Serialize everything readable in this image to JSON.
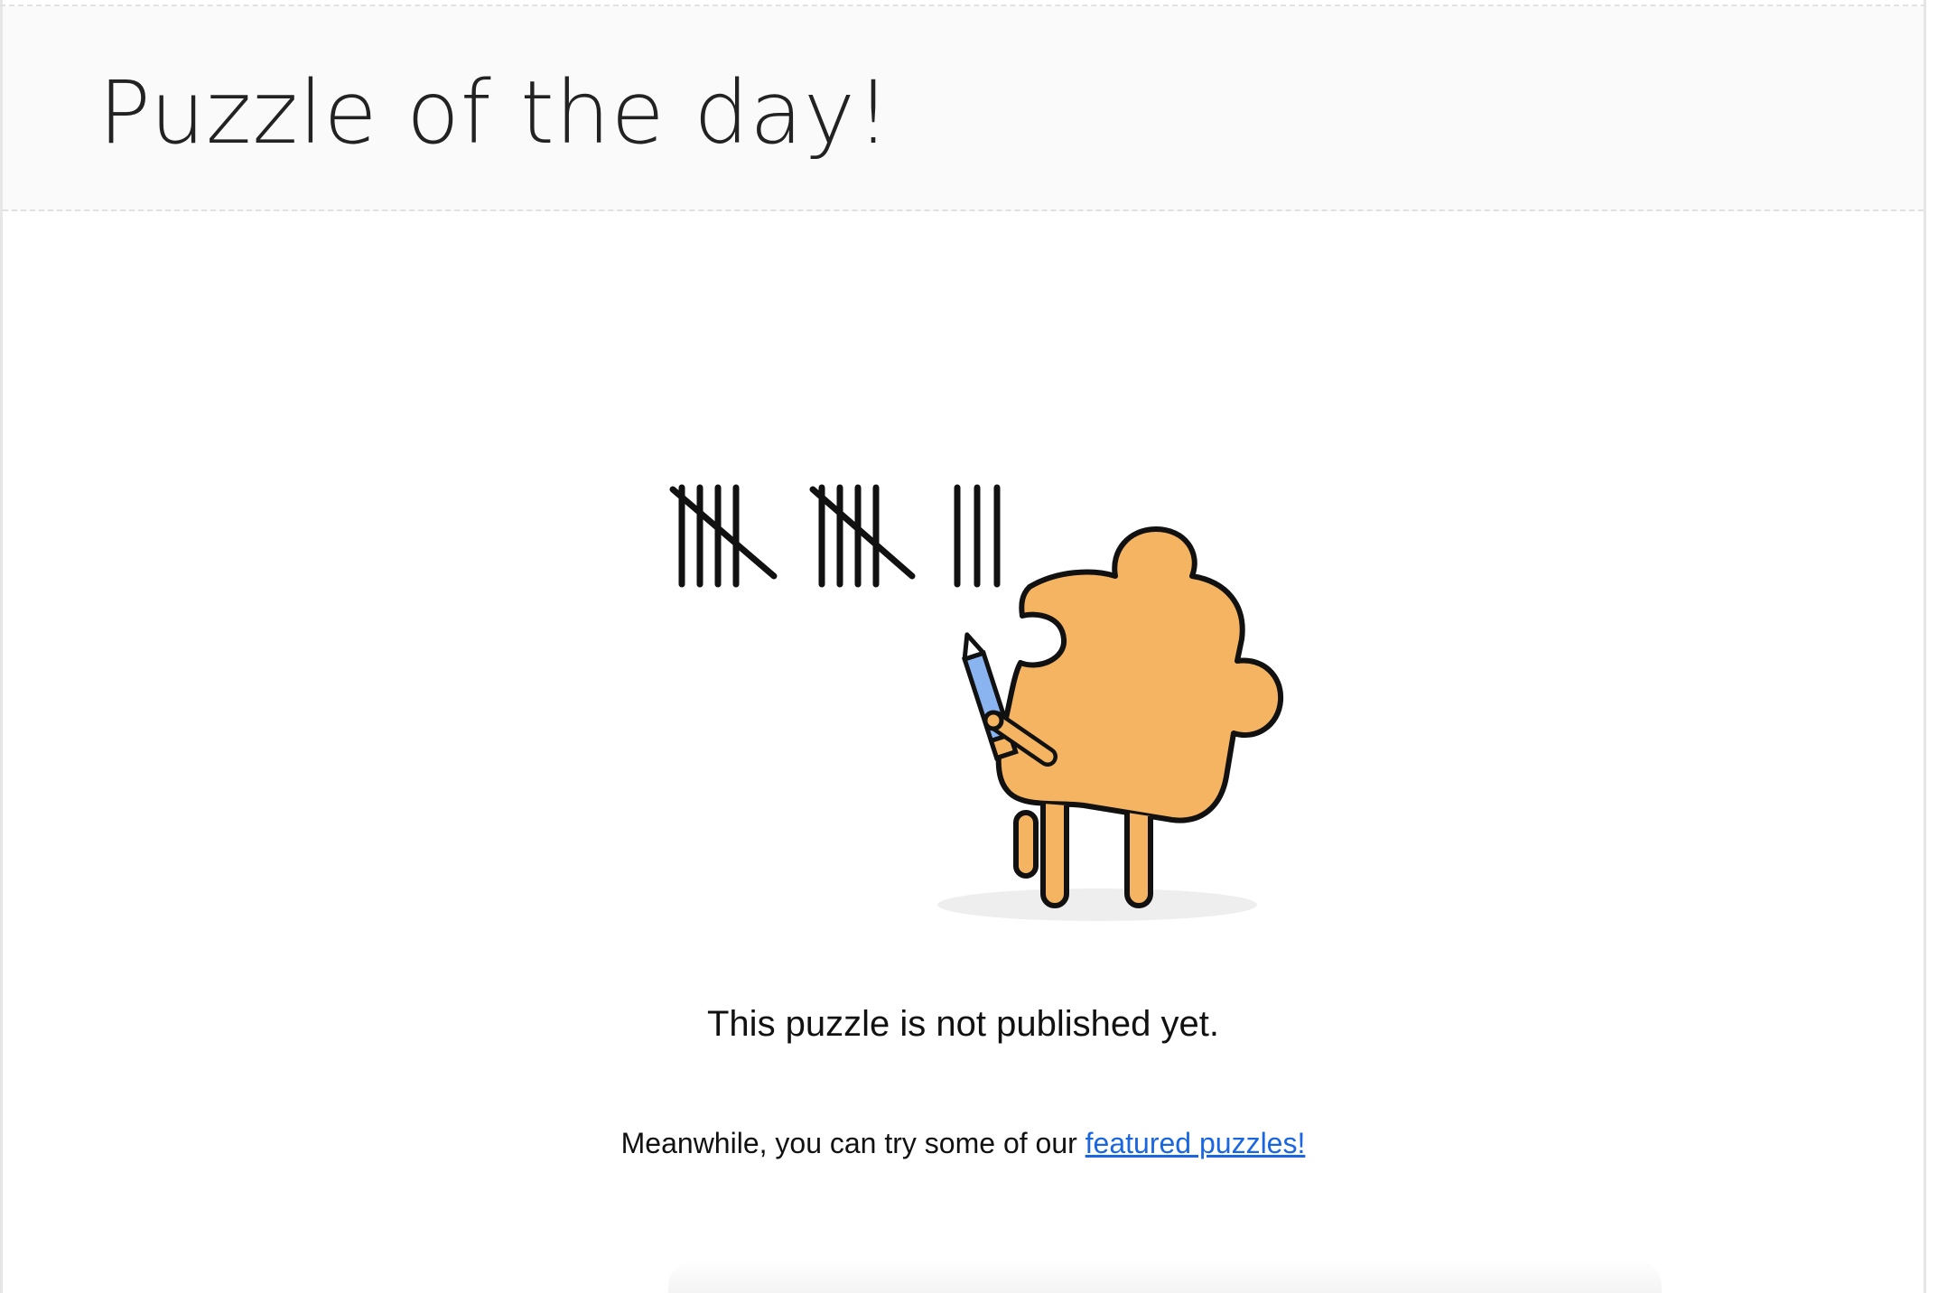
{
  "header": {
    "title": "Puzzle of the day!"
  },
  "illustration": {
    "icon": "puzzle-mascot-tally-icon",
    "tally_count": 13,
    "colors": {
      "puzzle_body": "#F4B462",
      "pencil": "#8AB4F0",
      "outline": "#111111",
      "shadow": "#EEEEEE"
    }
  },
  "main": {
    "message": "This puzzle is not published yet.",
    "submessage_prefix": "Meanwhile, you can try some of our ",
    "featured_link_label": "featured puzzles!"
  },
  "colors": {
    "link": "#1A66E0",
    "header_background": "#FAFAFA",
    "border": "#E6E6E6"
  }
}
